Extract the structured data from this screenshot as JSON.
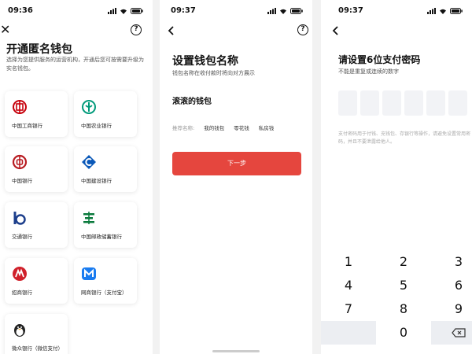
{
  "status": {
    "p1_time": "09:36",
    "p2_time": "09:37",
    "p3_time": "09:37"
  },
  "panel1": {
    "title": "开通匿名钱包",
    "description": "选择为您提供服务的运营机构，开通后您可按需要升级为实名钱包。",
    "banks": [
      {
        "name": "中国工商银行",
        "icon": "icbc-logo-icon",
        "color": "#c7000b"
      },
      {
        "name": "中国农业银行",
        "icon": "abc-logo-icon",
        "color": "#009a7a"
      },
      {
        "name": "中国银行",
        "icon": "boc-logo-icon",
        "color": "#b81c22"
      },
      {
        "name": "中国建设银行",
        "icon": "ccb-logo-icon",
        "color": "#0a58b8"
      },
      {
        "name": "交通银行",
        "icon": "bocom-logo-icon",
        "color": "#1d3f8c"
      },
      {
        "name": "中国邮政储蓄银行",
        "icon": "psbc-logo-icon",
        "color": "#0a7a3c"
      },
      {
        "name": "招商银行",
        "icon": "cmb-logo-icon",
        "color": "#d0202a"
      },
      {
        "name": "网商银行（支付宝）",
        "icon": "mybank-logo-icon",
        "color": "#1a7cf0"
      },
      {
        "name": "微众银行（微信支付）",
        "icon": "webank-logo-icon",
        "color": "#222222"
      }
    ]
  },
  "panel2": {
    "title": "设置钱包名称",
    "description": "钱包名称在收付款时将向对方展示",
    "wallet_name": "滚滚的钱包",
    "suggest_label": "推荐名称:",
    "suggestions": [
      "我的钱包",
      "零花钱",
      "私房钱"
    ],
    "next_button": "下一步",
    "accent": "#e5463e"
  },
  "panel3": {
    "title": "请设置6位支付密码",
    "description": "不能是重复或连续的数字",
    "note": "支付密码用于付钱、充钱包、存银行等操作，请避免设置常用密码，并且不要泄露给他人。",
    "keys": [
      "1",
      "2",
      "3",
      "4",
      "5",
      "6",
      "7",
      "8",
      "9",
      "",
      "0",
      "⌫"
    ]
  }
}
